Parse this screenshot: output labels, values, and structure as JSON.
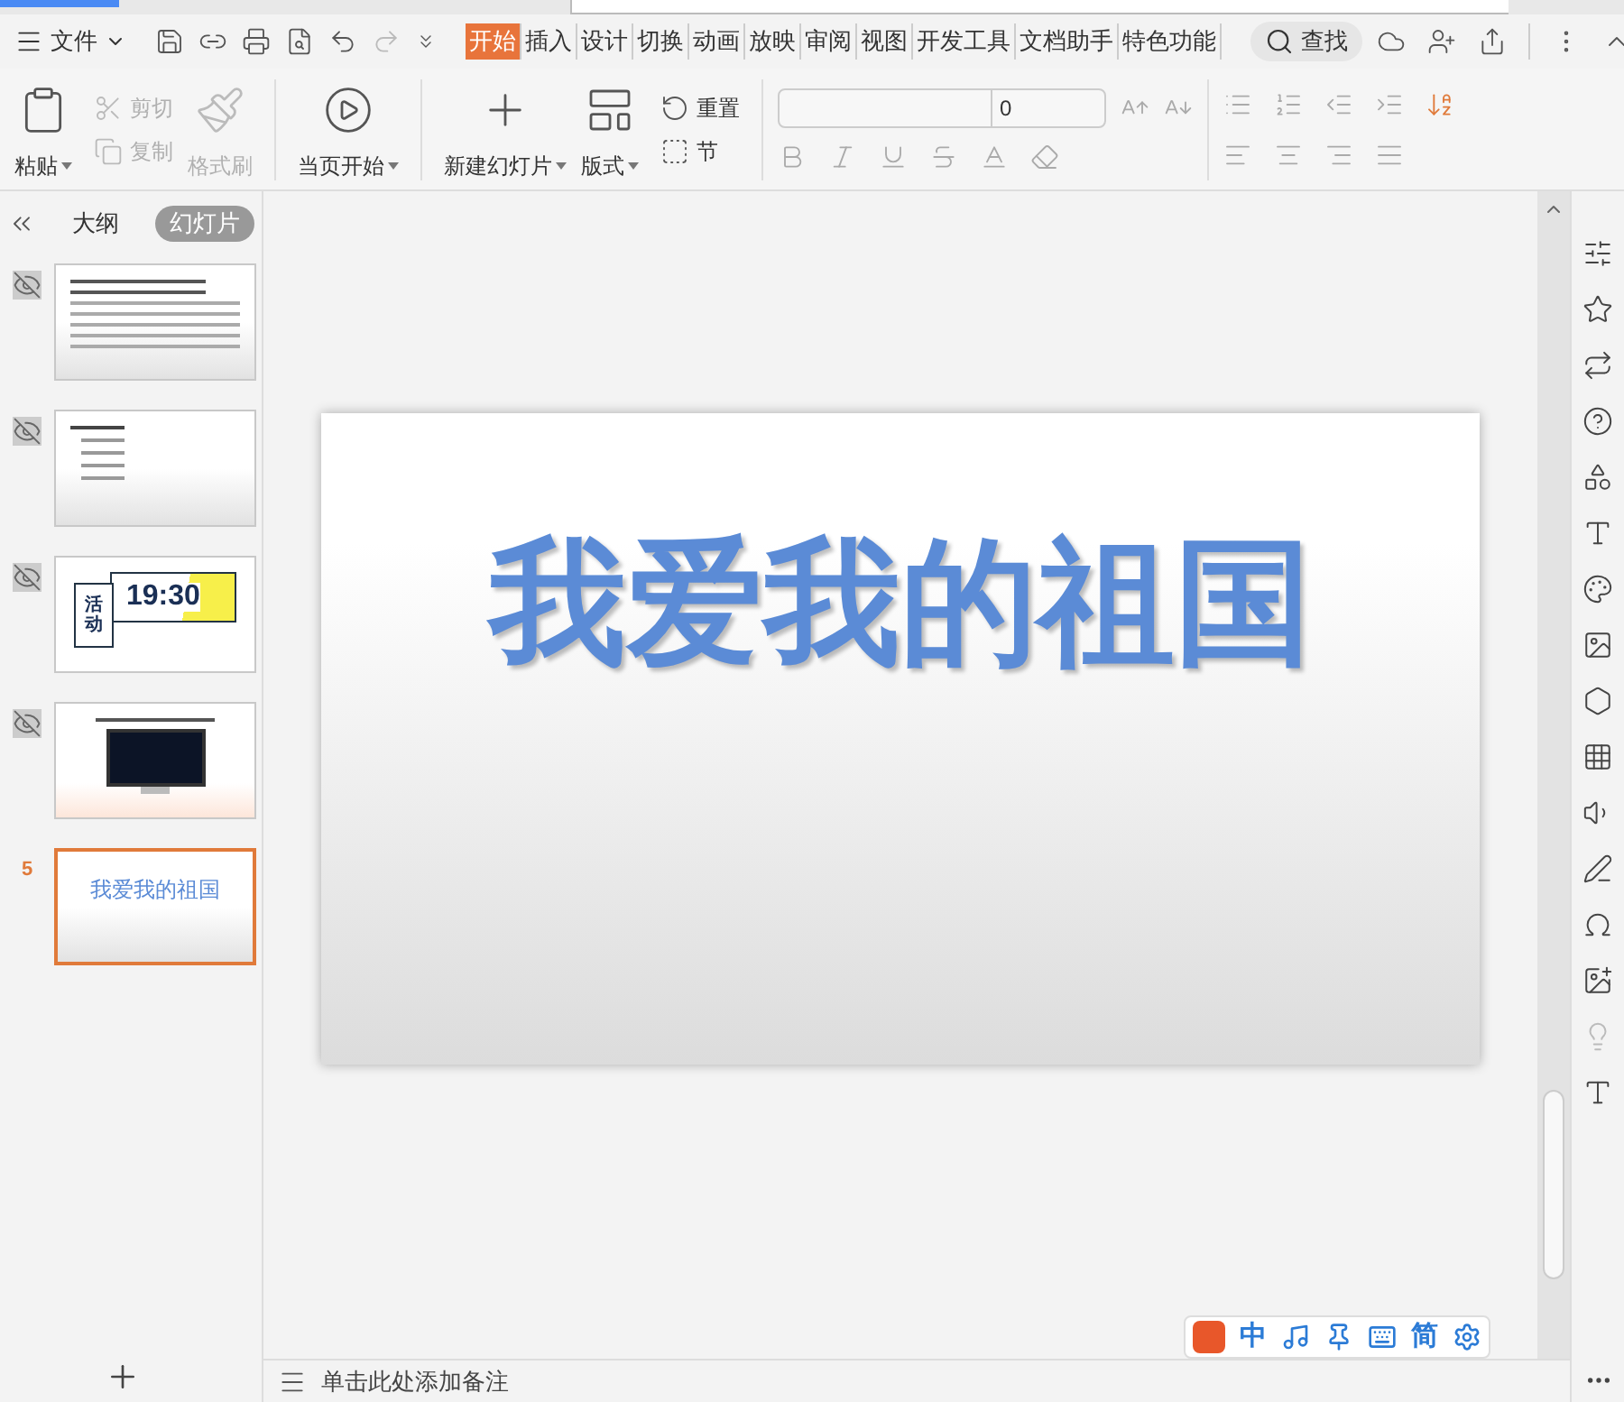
{
  "menu": {
    "file_label": "文件"
  },
  "tabs": [
    {
      "label": "开始",
      "selected": true
    },
    {
      "label": "插入",
      "selected": false
    },
    {
      "label": "设计",
      "selected": false
    },
    {
      "label": "切换",
      "selected": false
    },
    {
      "label": "动画",
      "selected": false
    },
    {
      "label": "放映",
      "selected": false
    },
    {
      "label": "审阅",
      "selected": false
    },
    {
      "label": "视图",
      "selected": false
    },
    {
      "label": "开发工具",
      "selected": false
    },
    {
      "label": "文档助手",
      "selected": false
    },
    {
      "label": "特色功能",
      "selected": false
    }
  ],
  "search": {
    "label": "查找"
  },
  "ribbon": {
    "paste": {
      "label": "粘贴"
    },
    "cut": {
      "label": "剪切",
      "disabled": true
    },
    "copy": {
      "label": "复制",
      "disabled": true
    },
    "format_painter": {
      "label": "格式刷",
      "disabled": true
    },
    "play": {
      "label": "当页开始"
    },
    "new_slide": {
      "label": "新建幻灯片"
    },
    "layout": {
      "label": "版式"
    },
    "reset": {
      "label": "重置"
    },
    "section": {
      "label": "节"
    },
    "font_size": {
      "value": "0"
    }
  },
  "panel_tabs": [
    {
      "label": "大纲",
      "selected": false
    },
    {
      "label": "幻灯片",
      "selected": true
    }
  ],
  "slides": [
    {
      "kind": "text",
      "hidden": true,
      "selected": false
    },
    {
      "kind": "list",
      "hidden": true,
      "selected": false
    },
    {
      "kind": "timer",
      "hidden": true,
      "selected": false,
      "badge": "活动",
      "time": "19:30"
    },
    {
      "kind": "monitor",
      "hidden": true,
      "selected": false
    },
    {
      "kind": "title",
      "hidden": false,
      "selected": true,
      "number": "5",
      "title": "我爱我的祖国"
    }
  ],
  "slide": {
    "title": "我爱我的祖国"
  },
  "notes": {
    "placeholder": "单击此处添加备注"
  },
  "ime": {
    "mode": "中",
    "script": "简"
  }
}
